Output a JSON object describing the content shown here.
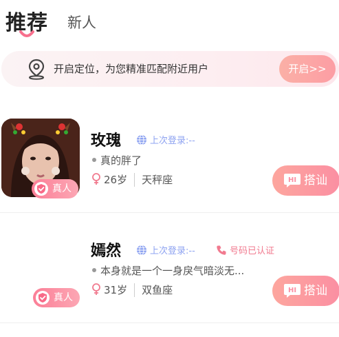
{
  "tabs": {
    "active": "推荐",
    "inactive": "新人"
  },
  "location_banner": {
    "text": "开启定位，为您精准匹配附近用户",
    "button": "开启>>"
  },
  "users": [
    {
      "name": "玫瑰",
      "last_login": "上次登录:--",
      "bio": "真的胖了",
      "age": "26岁",
      "zodiac": "天秤座",
      "badge": "真人",
      "chat_button": "搭讪",
      "has_avatar": true
    },
    {
      "name": "嫣然",
      "last_login": "上次登录:--",
      "phone_verified": "号码已认证",
      "bio": "本身就是一个一身戾气暗淡无...",
      "age": "31岁",
      "zodiac": "双鱼座",
      "badge": "真人",
      "chat_button": "搭讪",
      "has_avatar": false
    }
  ],
  "colors": {
    "accent_pink": "#fb8fa2",
    "login_blue": "#8ea3f1",
    "verified_red": "#f17a8f"
  },
  "icons": {
    "location": "location-pin-icon",
    "globe": "globe-icon",
    "phone": "phone-icon",
    "female": "female-icon",
    "verified": "verified-shield-icon",
    "chat": "hi-chat-icon"
  }
}
